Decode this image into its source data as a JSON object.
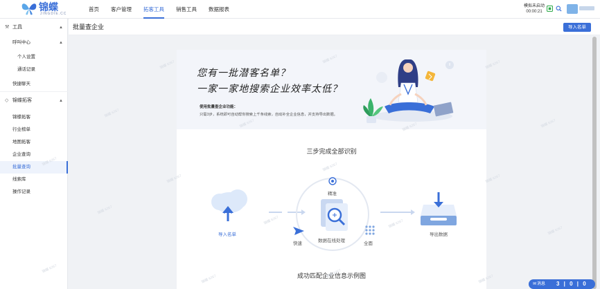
{
  "brand": {
    "name": "锦蝶",
    "sub": "JINGDIE.CC"
  },
  "nav": [
    {
      "label": "首页"
    },
    {
      "label": "客户管理"
    },
    {
      "label": "拓客工具"
    },
    {
      "label": "销售工具"
    },
    {
      "label": "数据报表"
    }
  ],
  "nav_active": "拓客工具",
  "call": {
    "status": "模拟未启动",
    "timer": "00:00:21"
  },
  "sidebar": {
    "groups": [
      {
        "label": "工具",
        "icon": "tools-icon"
      },
      {
        "label": "锦蝶拓客",
        "icon": "diamond-icon"
      }
    ],
    "items": [
      {
        "label": "呼叫中心"
      },
      {
        "label": "个人设置"
      },
      {
        "label": "通话记录"
      },
      {
        "label": "快捷聊天"
      },
      {
        "label": "锦蝶拓客"
      },
      {
        "label": "行业榜单"
      },
      {
        "label": "地图拓客"
      },
      {
        "label": "企业查询"
      },
      {
        "label": "批量查询"
      },
      {
        "label": "线索库"
      },
      {
        "label": "操作记录"
      }
    ]
  },
  "page": {
    "title": "批量查企业",
    "import_button": "导入名单"
  },
  "hero": {
    "line1": "您有一批潜客名单？",
    "line2": "一家一家地搜索企业效率太低？",
    "feature_title": "使用批量查企业功能：",
    "feature_desc": "只需3步，系统即可自动帮你搜索上千条线索，自动补全企业信息，并支持导出数据。"
  },
  "steps": {
    "title": "三步完成全部识别",
    "import": "导入名单",
    "center": "数据在线处理",
    "precise": "精准",
    "fast": "快速",
    "complete": "全面",
    "export": "导出数据"
  },
  "match_title": "成功匹配企业信息示例图",
  "watermark": "锦蝶 6267",
  "messages": {
    "label": "消息",
    "count": "3 | 0 | 0"
  },
  "colors": {
    "accent": "#3a6fd8",
    "hero_bg": "#f3f5fa"
  }
}
